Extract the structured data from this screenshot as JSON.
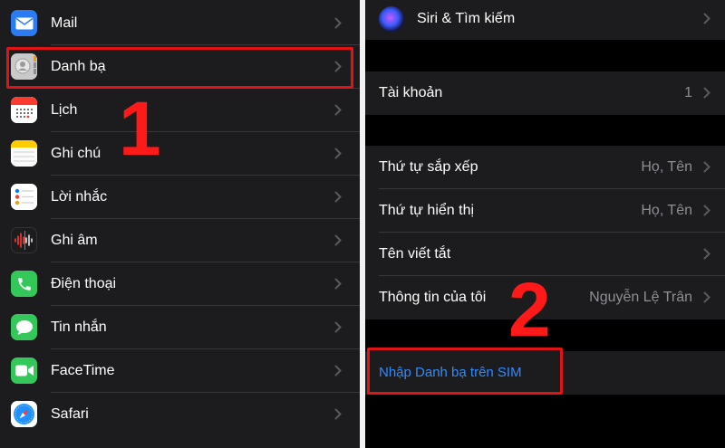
{
  "left": {
    "items": [
      {
        "label": "Mail",
        "icon": "mail-icon",
        "color": "#2b7bf2"
      },
      {
        "label": "Danh bạ",
        "icon": "contacts-icon",
        "color": "#bdbdbd"
      },
      {
        "label": "Lịch",
        "icon": "calendar-icon",
        "color": "#ffffff"
      },
      {
        "label": "Ghi chú",
        "icon": "notes-icon",
        "color": "#ffffff"
      },
      {
        "label": "Lời nhắc",
        "icon": "reminders-icon",
        "color": "#ffffff"
      },
      {
        "label": "Ghi âm",
        "icon": "voice-memos-icon",
        "color": "#1c1c1e"
      },
      {
        "label": "Điện thoại",
        "icon": "phone-icon",
        "color": "#34c759"
      },
      {
        "label": "Tin nhắn",
        "icon": "messages-icon",
        "color": "#34c759"
      },
      {
        "label": "FaceTime",
        "icon": "facetime-icon",
        "color": "#34c759"
      },
      {
        "label": "Safari",
        "icon": "safari-icon",
        "color": "#ffffff"
      }
    ],
    "step_label": "1"
  },
  "right": {
    "siri": {
      "label": "Siri & Tìm kiếm",
      "icon": "siri-icon"
    },
    "accounts": {
      "label": "Tài khoản",
      "value": "1"
    },
    "sort_order": {
      "label": "Thứ tự sắp xếp",
      "value": "Họ, Tên"
    },
    "display_order": {
      "label": "Thứ tự hiển thị",
      "value": "Họ, Tên"
    },
    "short_name": {
      "label": "Tên viết tắt",
      "value": ""
    },
    "my_info": {
      "label": "Thông tin của tôi",
      "value": "Nguyễn Lệ Trân"
    },
    "import_sim": {
      "label": "Nhập Danh bạ trên SIM"
    },
    "step_label": "2"
  },
  "colors": {
    "accent": "#2f8cff",
    "highlight": "#e01414"
  }
}
